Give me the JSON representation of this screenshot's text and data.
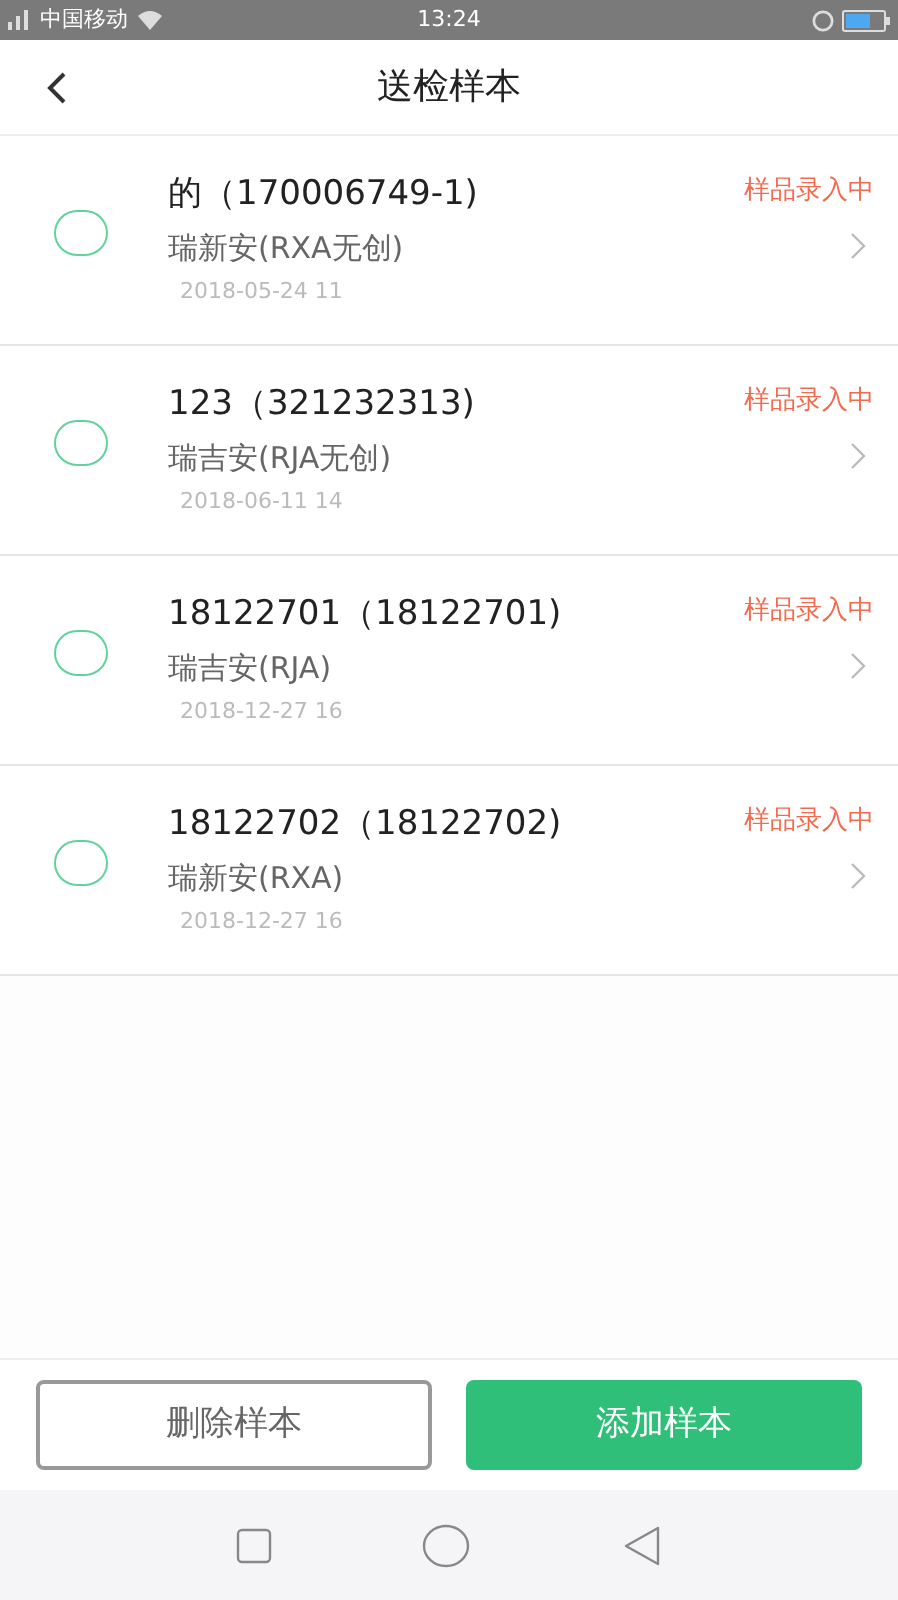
{
  "status_bar": {
    "carrier": "中国移动",
    "time": "13:24"
  },
  "header": {
    "title": "送检样本"
  },
  "samples": [
    {
      "title": "的（170006749-1)",
      "product": "瑞新安(RXA无创)",
      "date": "2018-05-24 11",
      "status": "样品录入中",
      "checked": false
    },
    {
      "title": "123（321232313)",
      "product": "瑞吉安(RJA无创)",
      "date": "2018-06-11 14",
      "status": "样品录入中",
      "checked": false
    },
    {
      "title": "18122701（18122701)",
      "product": "瑞吉安(RJA)",
      "date": "2018-12-27 16",
      "status": "样品录入中",
      "checked": false
    },
    {
      "title": "18122702（18122702)",
      "product": "瑞新安(RXA)",
      "date": "2018-12-27 16",
      "status": "样品录入中",
      "checked": false
    }
  ],
  "buttons": {
    "delete": "删除样本",
    "add": "添加样本"
  }
}
